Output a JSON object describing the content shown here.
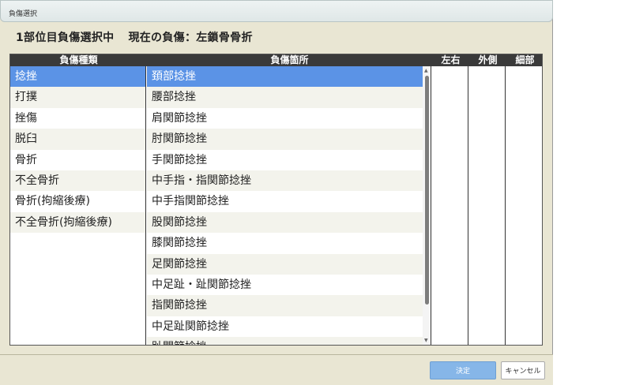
{
  "window": {
    "title": "負傷選択"
  },
  "heading": {
    "prefix": "1部位目負傷選択中",
    "current": "現在の負傷：左鎖骨骨折"
  },
  "table": {
    "headers": {
      "type": "負傷種類",
      "site": "負傷箇所",
      "lr": "左右",
      "outer": "外側",
      "detail": "細部"
    },
    "injury_types": [
      "捻挫",
      "打撲",
      "挫傷",
      "脱臼",
      "骨折",
      "不全骨折",
      "骨折(拘縮後療)",
      "不全骨折(拘縮後療)"
    ],
    "selected_type": "捻挫",
    "injury_sites": [
      "頚部捻挫",
      "腰部捻挫",
      "肩関節捻挫",
      "肘関節捻挫",
      "手関節捻挫",
      "中手指・指関節捻挫",
      "中手指関節捻挫",
      "股関節捻挫",
      "膝関節捻挫",
      "足関節捻挫",
      "中足趾・趾関節捻挫",
      "指関節捻挫",
      "中足趾関節捻挫",
      "趾関節捻挫"
    ],
    "selected_site": "頚部捻挫"
  },
  "buttons": {
    "ok": "決定",
    "cancel": "キャンセル"
  }
}
